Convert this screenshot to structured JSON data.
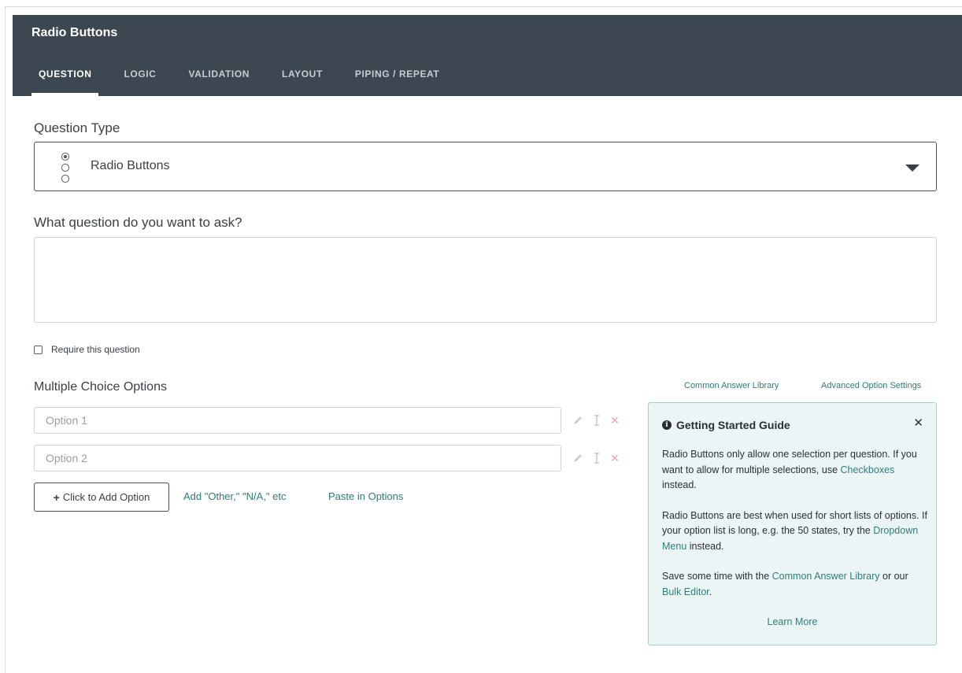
{
  "header": {
    "title": "Radio Buttons",
    "tabs": [
      {
        "label": "QUESTION",
        "active": true
      },
      {
        "label": "LOGIC"
      },
      {
        "label": "VALIDATION"
      },
      {
        "label": "LAYOUT"
      },
      {
        "label": "PIPING / REPEAT"
      }
    ]
  },
  "question_type": {
    "label": "Question Type",
    "selected": "Radio Buttons"
  },
  "question_prompt": {
    "label": "What question do you want to ask?",
    "value": ""
  },
  "require": {
    "label": "Require this question",
    "checked": false
  },
  "options": {
    "label": "Multiple Choice Options",
    "common_library_link": "Common Answer Library",
    "advanced_settings_link": "Advanced Option Settings",
    "items": [
      {
        "placeholder": "Option 1"
      },
      {
        "placeholder": "Option 2"
      }
    ],
    "add_button": "Click to Add Option",
    "add_other_link": "Add \"Other,\" \"N/A,\" etc",
    "paste_link": "Paste in Options"
  },
  "guide": {
    "title": "Getting Started Guide",
    "p1_text1": "Radio Buttons only allow one selection per question. If you want to allow for multiple selections, use ",
    "p1_link": "Checkboxes",
    "p1_text2": " instead.",
    "p2_text1": "Radio Buttons are best when used for short lists of options. If your option list is long, e.g. the 50 states, try the ",
    "p2_link": "Dropdown Menu",
    "p2_text2": " instead.",
    "p3_text1": "Save some time with the ",
    "p3_link1": "Common Answer Library",
    "p3_text2": " or our ",
    "p3_link2": "Bulk Editor",
    "p3_text3": ".",
    "learn_more": "Learn More"
  },
  "colors": {
    "header_bg": "#3d4752",
    "link": "#2e7d78",
    "guide_bg": "#ecf5f5",
    "guide_border": "#9fcfcb"
  }
}
